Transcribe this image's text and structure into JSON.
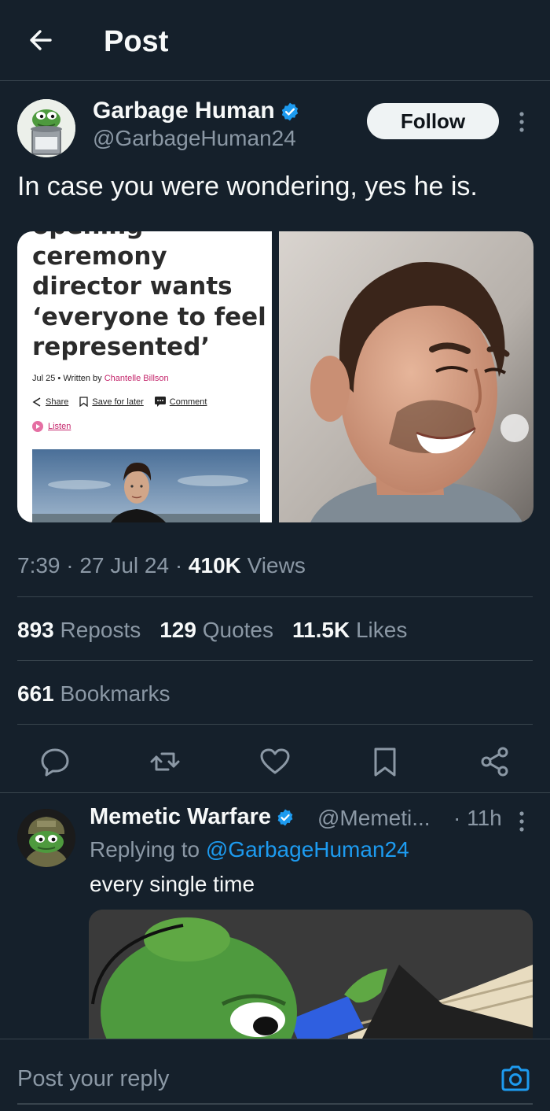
{
  "header": {
    "title": "Post"
  },
  "post": {
    "author_name": "Garbage Human",
    "author_handle": "@GarbageHuman24",
    "follow_label": "Follow",
    "text": "In case you were wondering, yes he is.",
    "article": {
      "headline_top": "opening",
      "headline": "ceremony director wants ‘everyone to feel represented’",
      "date": "Jul 25",
      "written_by": "Written by",
      "author": "Chantelle Billson",
      "share_label": "Share",
      "save_label": "Save for later",
      "comment_label": "Comment",
      "listen_label": "Listen"
    },
    "time": "7:39",
    "date": "27 Jul 24",
    "views_count": "410K",
    "views_label": "Views",
    "reposts_count": "893",
    "reposts_label": "Reposts",
    "quotes_count": "129",
    "quotes_label": "Quotes",
    "likes_count": "11.5K",
    "likes_label": "Likes",
    "bookmarks_count": "661",
    "bookmarks_label": "Bookmarks"
  },
  "reply": {
    "author_name": "Memetic Warfare",
    "author_handle": "@Memeti...",
    "time": "· 11h",
    "replying_prefix": "Replying to",
    "replying_to": "@GarbageHuman24",
    "text": "every single time"
  },
  "composer": {
    "placeholder": "Post your reply"
  },
  "icons": {
    "back": "arrow-left-icon",
    "verified": "verified-badge-icon",
    "more": "more-vertical-icon",
    "reply": "reply-icon",
    "repost": "repost-icon",
    "like": "heart-icon",
    "bookmark": "bookmark-icon",
    "share": "share-icon",
    "camera": "camera-icon"
  },
  "colors": {
    "background": "#15202b",
    "accent": "#1d9bf0",
    "muted": "#8b98a5",
    "divider": "#38444d"
  }
}
